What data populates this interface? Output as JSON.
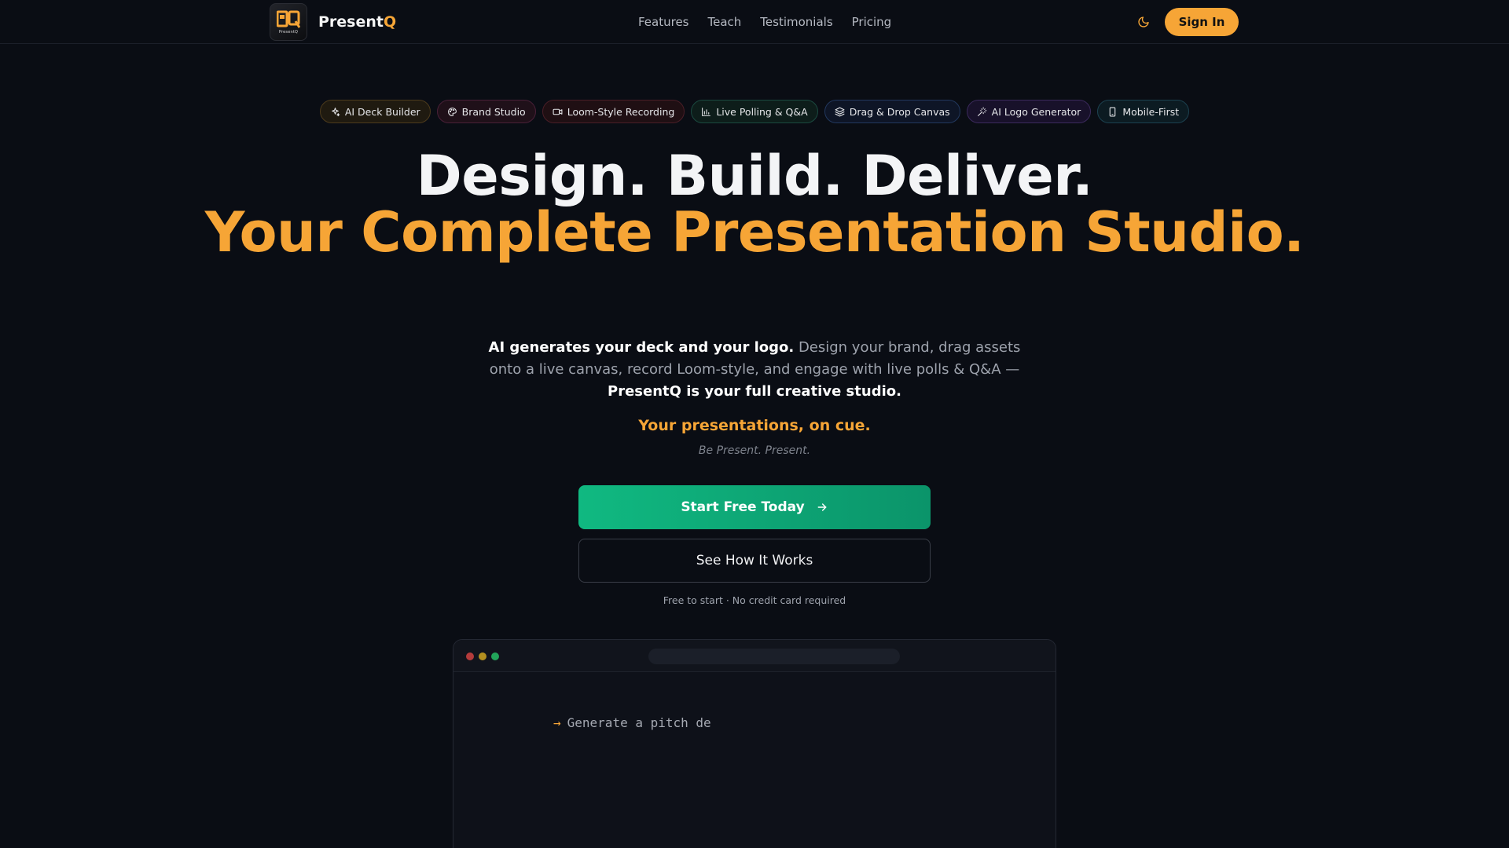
{
  "nav": {
    "logo_subtext": "PresentQ",
    "brand_main": "Present",
    "brand_accent": "Q",
    "links": [
      "Features",
      "Teach",
      "Testimonials",
      "Pricing"
    ],
    "signin_label": "Sign In"
  },
  "pills": [
    {
      "label": "AI Deck Builder",
      "icon": "sparkles-icon"
    },
    {
      "label": "Brand Studio",
      "icon": "palette-icon"
    },
    {
      "label": "Loom-Style Recording",
      "icon": "video-icon"
    },
    {
      "label": "Live Polling & Q&A",
      "icon": "bar-chart-icon"
    },
    {
      "label": "Drag & Drop Canvas",
      "icon": "layers-icon"
    },
    {
      "label": "AI Logo Generator",
      "icon": "magic-wand-icon"
    },
    {
      "label": "Mobile-First",
      "icon": "smartphone-icon"
    }
  ],
  "hero": {
    "title_line1": "Design. Build. Deliver.",
    "title_line2": "Your Complete Presentation Studio.",
    "desc_bold1": "AI generates your deck and your logo.",
    "desc_mid": " Design your brand, drag assets onto a live canvas, record Loom-style, and engage with live polls & Q&A — ",
    "desc_bold2": "PresentQ is your full creative studio.",
    "tagline": "Your presentations, on cue.",
    "subtag": "Be Present. Present.",
    "cta_primary": "Start Free Today",
    "cta_secondary": "See How It Works",
    "fine_print": "Free to start · No credit card required"
  },
  "preview": {
    "prompt_text": "Generate a pitch de"
  },
  "colors": {
    "accent": "#f6a536",
    "cta_green": "#10b981",
    "background": "#0a0d14"
  }
}
